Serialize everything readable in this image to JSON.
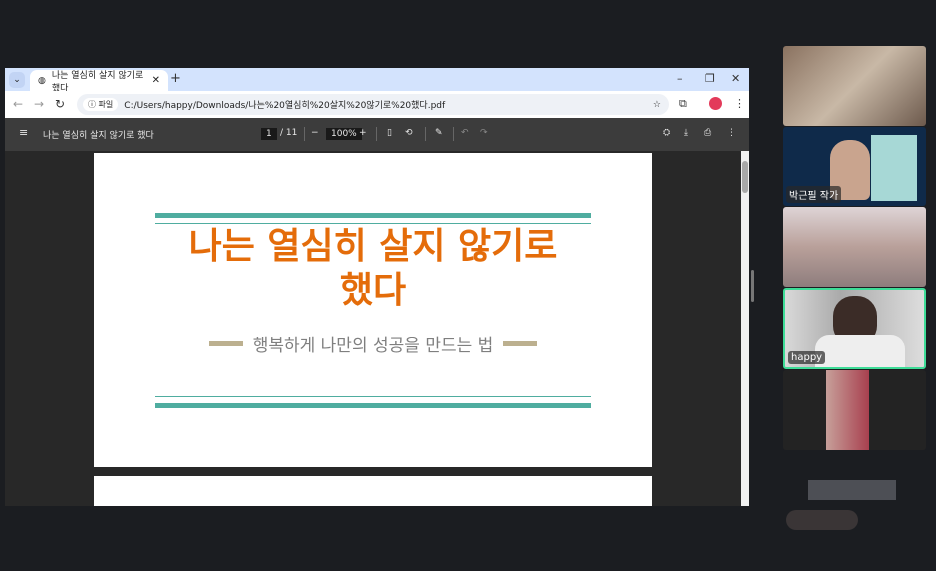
{
  "browser": {
    "tab_title": "나는 열심히 살지 않기로 했다",
    "new_tab": "+",
    "address_chip": "파일",
    "url": "C:/Users/happy/Downloads/나는%20열심히%20살지%20않기로%20했다.pdf",
    "minimize": "–",
    "maximize": "❐",
    "close": "✕"
  },
  "pdf": {
    "title": "나는 열심히 살지 않기로 했다",
    "page_current": "1",
    "page_total": "/ 11",
    "zoom": "100%"
  },
  "slide": {
    "title_line1": "나는 열심히 살지 않기로",
    "title_line2": "했다",
    "subtitle": "행복하게 나만의 성공을 만드는 법"
  },
  "participants": [
    {
      "name": ""
    },
    {
      "name": "박근필 작가"
    },
    {
      "name": ""
    },
    {
      "name": "happy",
      "active": true
    },
    {
      "name": ""
    }
  ],
  "colors": {
    "accent": "#e46c0a",
    "teal": "#4fada0",
    "speaker": "#3ddc97"
  }
}
